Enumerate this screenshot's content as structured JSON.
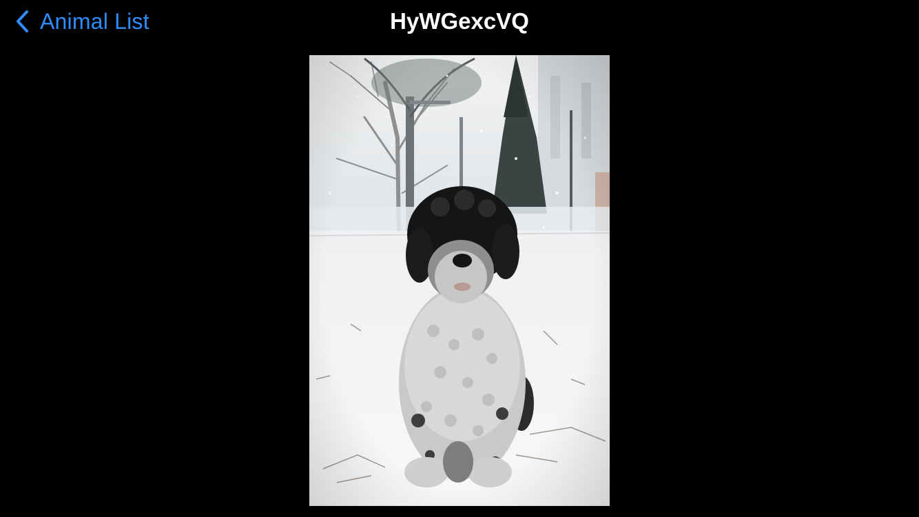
{
  "nav": {
    "back_label": "Animal List",
    "back_icon": "chevron-left-icon",
    "title": "HyWGexcVQ"
  },
  "photo": {
    "subject": "dog-photo"
  },
  "colors": {
    "background": "#000000",
    "accent": "#2f8cff",
    "title": "#ffffff"
  }
}
